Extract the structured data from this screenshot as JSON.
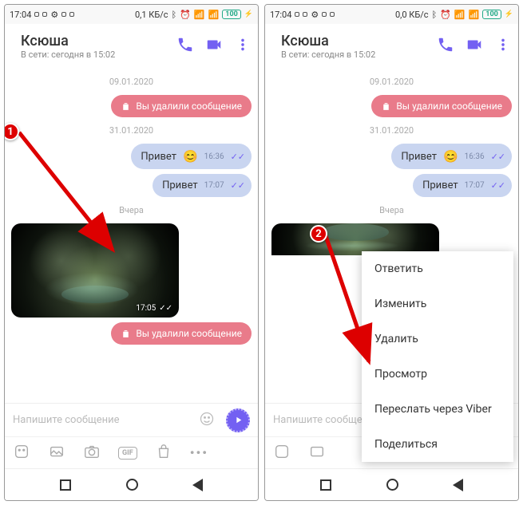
{
  "statusbar": {
    "time": "17:04",
    "time2": "17:04",
    "speed1": "0,1 КБ/с",
    "speed2": "0,0 КБ/с",
    "battery": "100"
  },
  "header": {
    "title": "Ксюша",
    "subtitle": "В сети: сегодня в 15:02"
  },
  "chat": {
    "date1": "09.01.2020",
    "deleted_text": "Вы удалили сообщение",
    "date2": "31.01.2020",
    "msg1": {
      "text": "Привет",
      "time": "16:36"
    },
    "msg2": {
      "text": "Привет",
      "time": "17:07"
    },
    "date3": "Вчера",
    "img_time": "17:05"
  },
  "input": {
    "placeholder": "Напишите сообщение"
  },
  "icons": {
    "gif_label": "GIF"
  },
  "context_menu": {
    "items": [
      "Ответить",
      "Изменить",
      "Удалить",
      "Просмотр",
      "Переслать через Viber",
      "Поделиться"
    ]
  },
  "annotations": {
    "n1": "1",
    "n2": "2"
  }
}
